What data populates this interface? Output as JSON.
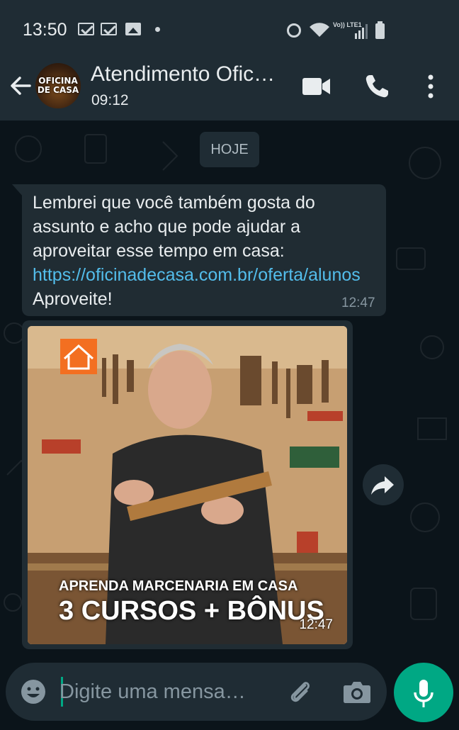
{
  "status_bar": {
    "time": "13:50",
    "network_label": "Vo)) LTE1"
  },
  "header": {
    "back_icon": "arrow-left-icon",
    "avatar_text": "OFICINA DE CASA",
    "title": "Atendimento Ofic…",
    "subtitle": "09:12",
    "icons": [
      "video-camera-icon",
      "phone-icon",
      "more-vertical-icon"
    ]
  },
  "chat": {
    "date_chip": "HOJE",
    "messages": [
      {
        "text_before_link": "Lembrei que você também gosta do assunto e acho que pode ajudar a aproveitar esse tempo em casa: ",
        "link": "https://oficinadecasa.com.br/oferta/alunos",
        "text_after_link": "  Aproveite!",
        "time": "12:47"
      },
      {
        "type": "image",
        "caption_line1": "APRENDA MARCENARIA EM CASA",
        "caption_line2": "3 CURSOS + BÔNUS",
        "time": "12:47"
      }
    ]
  },
  "input_bar": {
    "placeholder": "Digite uma mensa…",
    "icons": [
      "emoji-icon",
      "paperclip-icon",
      "camera-icon",
      "microphone-icon"
    ]
  },
  "colors": {
    "background": "#0b141a",
    "bar": "#1f2c34",
    "bubble": "#202c33",
    "link": "#53bdeb",
    "accent": "#00a884"
  }
}
